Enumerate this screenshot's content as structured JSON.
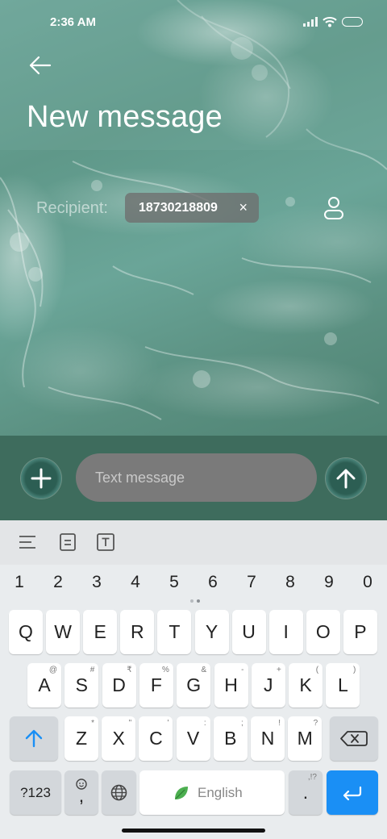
{
  "status_bar": {
    "time": "2:36 AM"
  },
  "header": {
    "title": "New message"
  },
  "recipient": {
    "label": "Recipient:",
    "chip_text": "18730218809",
    "chip_close": "×"
  },
  "compose": {
    "placeholder": "Text message"
  },
  "keyboard": {
    "numbers": [
      "1",
      "2",
      "3",
      "4",
      "5",
      "6",
      "7",
      "8",
      "9",
      "0"
    ],
    "row1": [
      {
        "ch": "Q"
      },
      {
        "ch": "W"
      },
      {
        "ch": "E"
      },
      {
        "ch": "R"
      },
      {
        "ch": "T"
      },
      {
        "ch": "Y"
      },
      {
        "ch": "U"
      },
      {
        "ch": "I"
      },
      {
        "ch": "O"
      },
      {
        "ch": "P"
      }
    ],
    "row2": [
      {
        "ch": "A",
        "hint": "@"
      },
      {
        "ch": "S",
        "hint": "#"
      },
      {
        "ch": "D",
        "hint": "₹"
      },
      {
        "ch": "F",
        "hint": "%"
      },
      {
        "ch": "G",
        "hint": "&"
      },
      {
        "ch": "H",
        "hint": "-"
      },
      {
        "ch": "J",
        "hint": "+"
      },
      {
        "ch": "K",
        "hint": "("
      },
      {
        "ch": "L",
        "hint": ")"
      }
    ],
    "row3": [
      {
        "ch": "Z",
        "hint": "*"
      },
      {
        "ch": "X",
        "hint": "\""
      },
      {
        "ch": "C",
        "hint": "'"
      },
      {
        "ch": "V",
        "hint": ":"
      },
      {
        "ch": "B",
        "hint": ";"
      },
      {
        "ch": "N",
        "hint": "!"
      },
      {
        "ch": "M",
        "hint": "?"
      }
    ],
    "symbols_key": "?123",
    "comma_key": ",",
    "space_label": "English",
    "period_key": ".",
    "period_hint": ",!?"
  },
  "colors": {
    "compose_bar": "#3e6c5d",
    "enter_key": "#1a8ff5",
    "shift_arrow": "#1a8ff5",
    "space_leaf": "#4caf50"
  }
}
